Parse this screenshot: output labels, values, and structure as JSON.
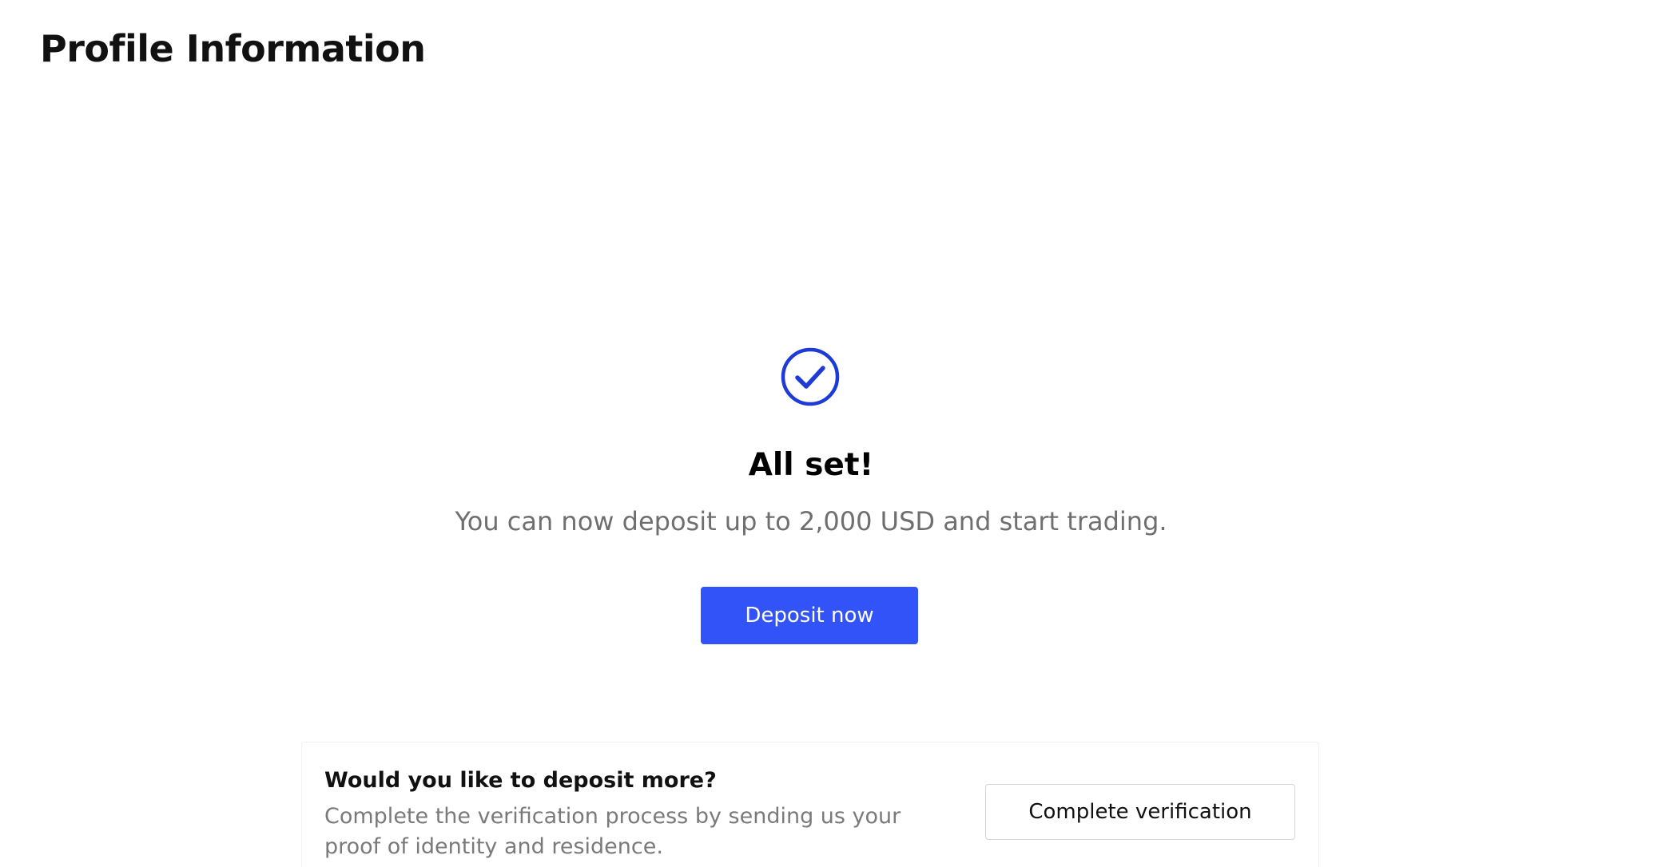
{
  "header": {
    "title": "Profile Information"
  },
  "success": {
    "icon": "check-circle-icon",
    "title": "All set!",
    "subtitle": "You can now deposit up to 2,000 USD and start trading.",
    "deposit_button_label": "Deposit now"
  },
  "deposit_more": {
    "title": "Would you like to deposit more?",
    "description": "Complete the verification process by sending us your proof of identity and residence.",
    "verify_button_label": "Complete verification"
  },
  "colors": {
    "accent": "#3253f7",
    "check_icon": "#1f3bd6",
    "muted_text": "#6f6f6f"
  }
}
